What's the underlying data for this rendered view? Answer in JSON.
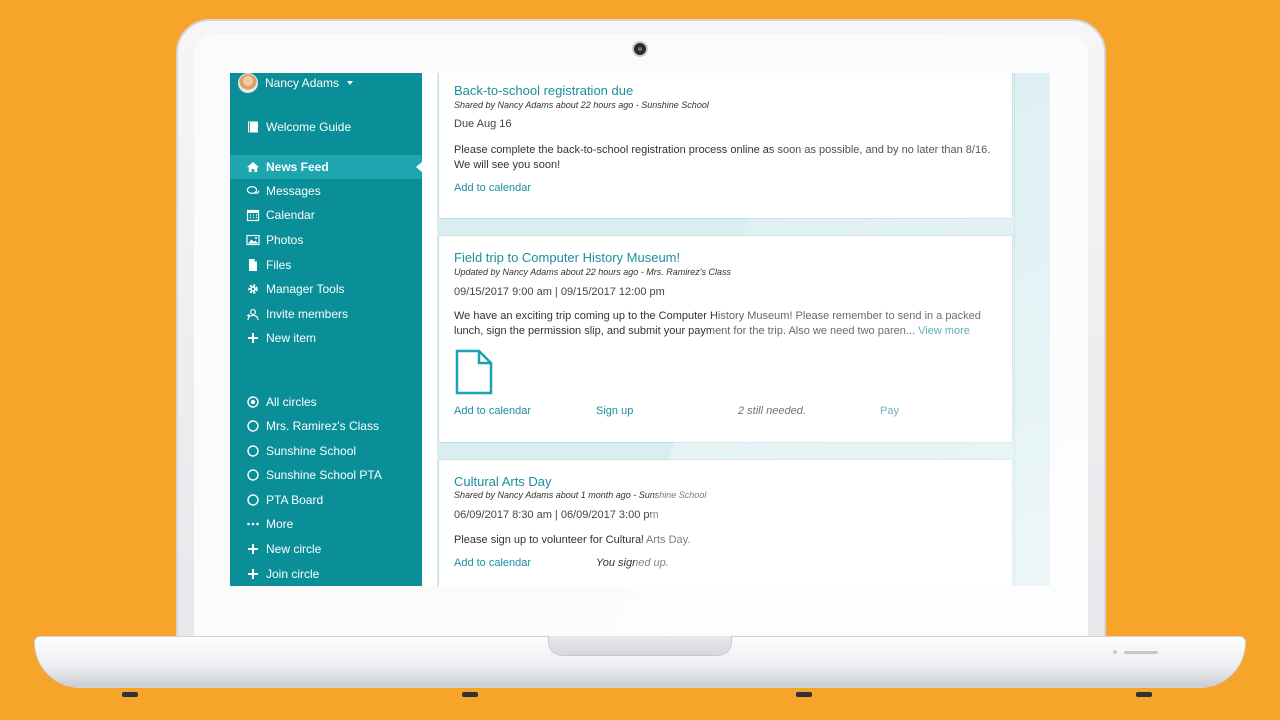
{
  "sidebar": {
    "user_name": "Nancy Adams",
    "welcome": "Welcome Guide",
    "nav": [
      {
        "label": "News Feed",
        "icon": "home-icon",
        "active": true
      },
      {
        "label": "Messages",
        "icon": "chat-icon"
      },
      {
        "label": "Calendar",
        "icon": "calendar-icon"
      },
      {
        "label": "Photos",
        "icon": "photo-icon"
      },
      {
        "label": "Files",
        "icon": "file-icon"
      },
      {
        "label": "Manager Tools",
        "icon": "gear-icon"
      },
      {
        "label": "Invite members",
        "icon": "invite-icon"
      },
      {
        "label": "New item",
        "icon": "plus-icon"
      }
    ],
    "circles": [
      {
        "label": "All circles",
        "icon": "radio-selected-icon"
      },
      {
        "label": "Mrs. Ramirez's Class",
        "icon": "radio-icon"
      },
      {
        "label": "Sunshine School",
        "icon": "radio-icon"
      },
      {
        "label": "Sunshine School PTA",
        "icon": "radio-icon"
      },
      {
        "label": "PTA Board",
        "icon": "radio-icon"
      },
      {
        "label": "More",
        "icon": "ellipsis-icon"
      },
      {
        "label": "New circle",
        "icon": "plus-icon"
      },
      {
        "label": "Join circle",
        "icon": "plus-icon"
      }
    ]
  },
  "posts": [
    {
      "title": "Back-to-school registration due",
      "meta": "Shared by Nancy Adams about 22 hours ago - Sunshine School",
      "date": "Due Aug 16",
      "body": "Please complete the back-to-school registration process online as soon as possible, and by no later than 8/16. We will see you soon!",
      "add_calendar": "Add to calendar"
    },
    {
      "title": "Field trip to Computer History Museum!",
      "meta": "Updated by Nancy Adams about 22 hours ago - Mrs. Ramirez's Class",
      "date": "09/15/2017 9:00 am | 09/15/2017 12:00 pm",
      "body": "We have an exciting trip coming up to the Computer History Museum! Please remember to send in a packed lunch, sign the permission slip, and submit your payment for the trip. Also we need two paren...",
      "view_more": "View more",
      "add_calendar": "Add to calendar",
      "sign_up": "Sign up",
      "still_needed": "2 still needed.",
      "pay": "Pay"
    },
    {
      "title": "Cultural Arts Day",
      "meta": "Shared by Nancy Adams about 1 month ago - Sunshine School",
      "date": "06/09/2017 8:30 am | 06/09/2017 3:00 pm",
      "body": "Please sign up to volunteer for Cultural Arts Day.",
      "add_calendar": "Add to calendar",
      "signed_up": "You signed up."
    }
  ],
  "colors": {
    "sidebar": "#0a8f99",
    "active": "#1ea6b0",
    "link": "#1a8fa0",
    "background": "#f7a42a"
  }
}
